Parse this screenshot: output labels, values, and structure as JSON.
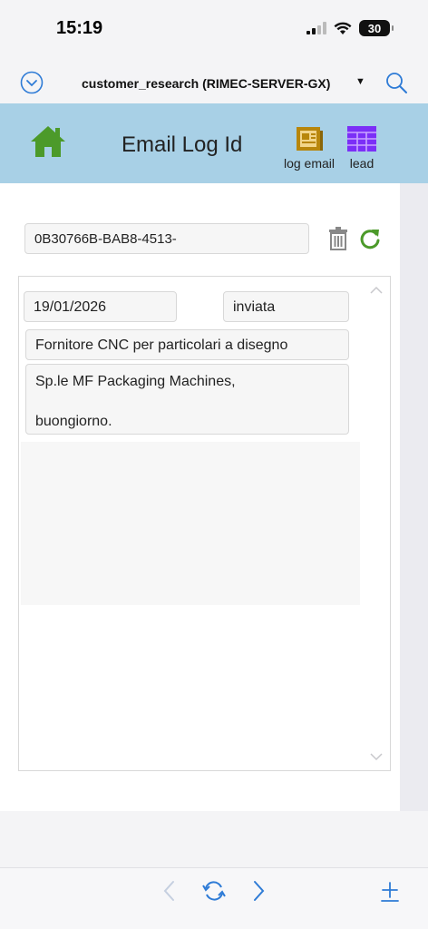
{
  "status_bar": {
    "time": "15:19",
    "battery": "30"
  },
  "nav": {
    "db_title": "customer_research (RIMEC-SERVER-GX)",
    "caret": "▼",
    "icons": [
      "chevron-circle-down-icon",
      "search-icon"
    ]
  },
  "header": {
    "title": "Email Log Id",
    "log_email_label": "log email",
    "lead_label": "lead",
    "colors": {
      "background": "#a8d0e6",
      "home": "#4c9a2a",
      "log_email": "#b8860b",
      "lead": "#7b2ff7"
    }
  },
  "form": {
    "email_log_id": "0B30766B-BAB8-4513-"
  },
  "record": {
    "date": "19/01/2026",
    "status": "inviata",
    "subject": "Fornitore CNC per particolari a disegno",
    "body_line1": "Sp.le MF Packaging Machines,",
    "body_line2": "buongiorno."
  },
  "bottom_bar": {
    "icons": [
      "back-arrow-icon",
      "sync-icon",
      "forward-arrow-icon",
      "plus-icon"
    ]
  }
}
